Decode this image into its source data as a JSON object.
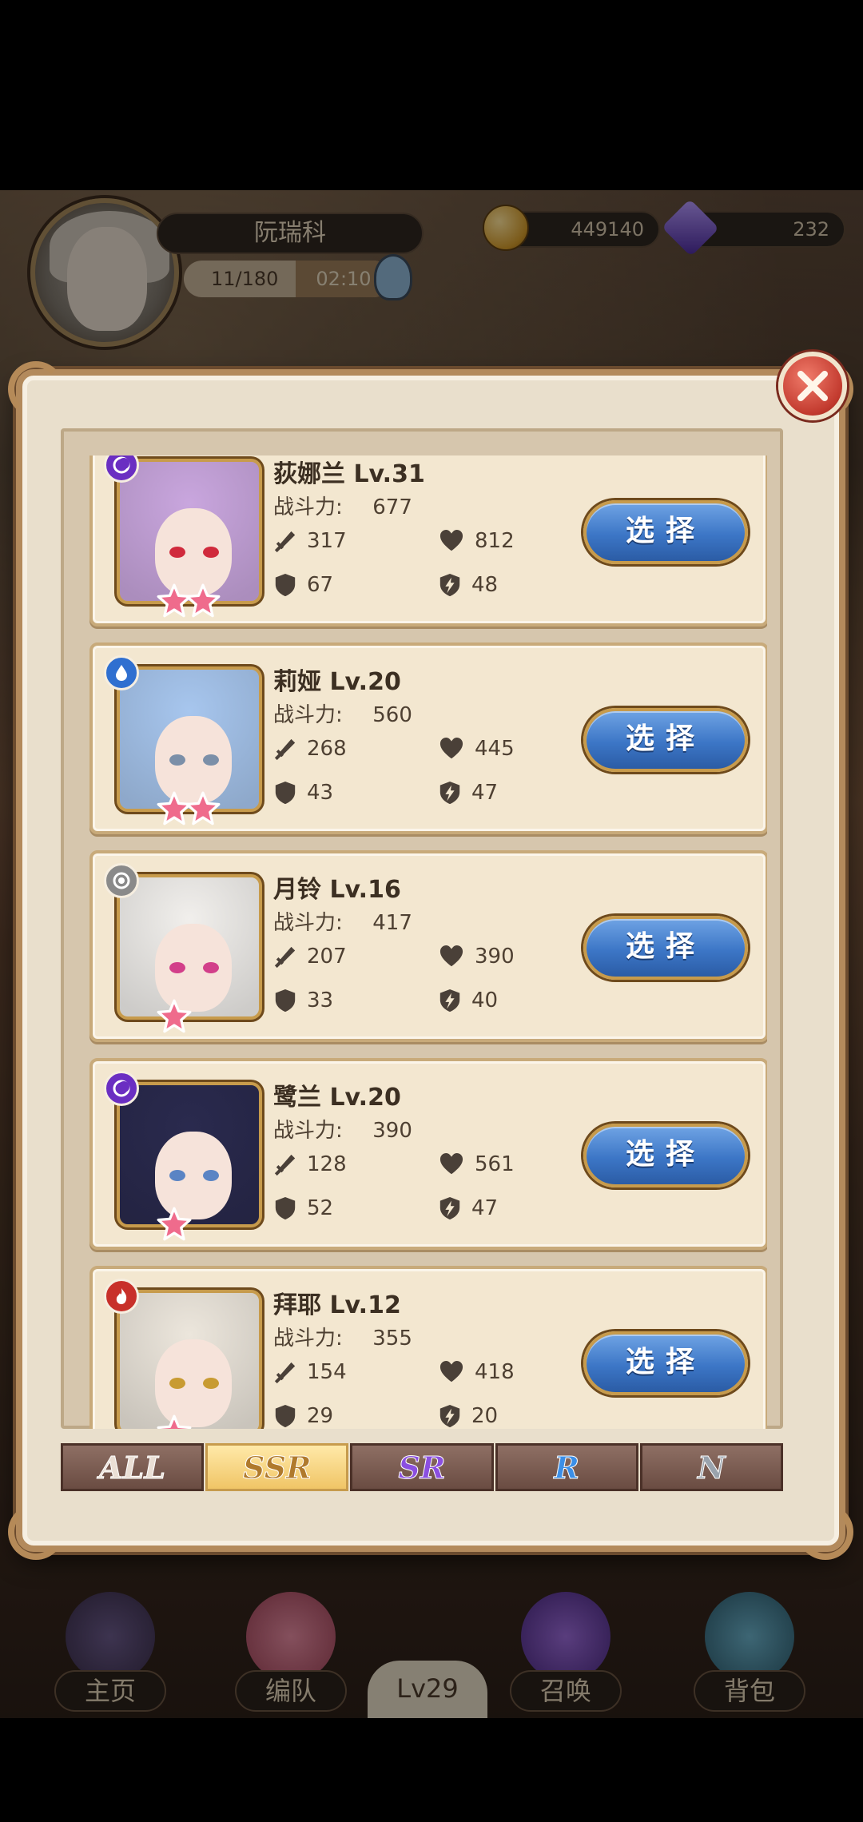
{
  "player": {
    "name": "阮瑞科",
    "stamina": "11/180",
    "refill_timer": "02:10",
    "gold": "449140",
    "gems": "232"
  },
  "bottom_nav": {
    "items": [
      {
        "label": "主页",
        "icon": "portal-icon"
      },
      {
        "label": "编队",
        "icon": "team-icon"
      },
      {
        "label": "召唤",
        "icon": "summon-crystal-icon"
      },
      {
        "label": "背包",
        "icon": "backpack-icon"
      }
    ],
    "level_badge": "Lv29"
  },
  "colors": {
    "element_water": "#2f6fd0",
    "element_dark": "#6a2ec2",
    "element_light": "#8a8a8a",
    "element_fire": "#c8302a",
    "star_pink": "#ef6b8c",
    "select_blue": "#3c76c6",
    "tab_active": "#f0c566"
  },
  "stat_labels": {
    "power": "战斗力:"
  },
  "heroes": [
    {
      "name": "荻娜兰 Lv.31",
      "power": "677",
      "atk": "317",
      "hp": "812",
      "def": "67",
      "spd": "48",
      "stars": 2,
      "element": "dark",
      "hair": "#c9a6de",
      "eye": "#d02a3c",
      "select_label": "选择"
    },
    {
      "name": "莉娅 Lv.20",
      "power": "560",
      "atk": "268",
      "hp": "445",
      "def": "43",
      "spd": "47",
      "stars": 2,
      "element": "water",
      "hair": "#a7c6ee",
      "eye": "#7b8fa8",
      "select_label": "选择"
    },
    {
      "name": "月铃 Lv.16",
      "power": "417",
      "atk": "207",
      "hp": "390",
      "def": "33",
      "spd": "40",
      "stars": 1,
      "element": "light",
      "hair": "#f1efec",
      "eye": "#d23f8a",
      "select_label": "选择"
    },
    {
      "name": "鹭兰 Lv.20",
      "power": "390",
      "atk": "128",
      "hp": "561",
      "def": "52",
      "spd": "47",
      "stars": 1,
      "element": "dark",
      "hair": "#2a2a4e",
      "eye": "#5a84c4",
      "select_label": "选择"
    },
    {
      "name": "拜耶 Lv.12",
      "power": "355",
      "atk": "154",
      "hp": "418",
      "def": "29",
      "spd": "20",
      "stars": 1,
      "element": "fire",
      "hair": "#ece6dc",
      "eye": "#c89b32",
      "select_label": "选择"
    }
  ],
  "filter_tabs": [
    {
      "label": "ALL",
      "color": "#eadfd5",
      "active": false
    },
    {
      "label": "SSR",
      "color": "#b07a2c",
      "active": true
    },
    {
      "label": "SR",
      "color": "#8b4fe0",
      "active": false
    },
    {
      "label": "R",
      "color": "#3b8fe8",
      "active": false
    },
    {
      "label": "N",
      "color": "#9aa3ad",
      "active": false
    }
  ]
}
